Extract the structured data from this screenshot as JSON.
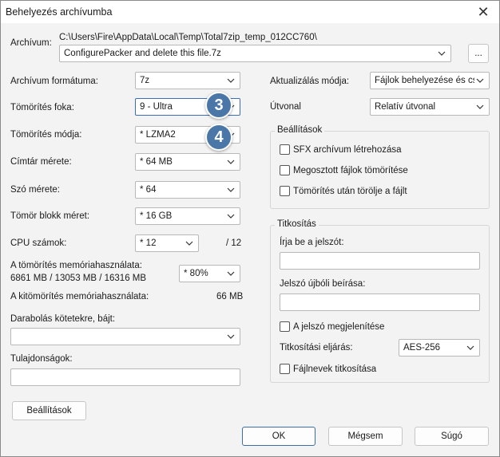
{
  "window": {
    "title": "Behelyezés archívumba",
    "close": "✕"
  },
  "archive": {
    "label": "Archívum:",
    "path": "C:\\Users\\Fire\\AppData\\Local\\Temp\\Total7zip_temp_012CC760\\",
    "name": "ConfigurePacker and delete this file.7z",
    "browse": "..."
  },
  "left": {
    "format_label": "Archívum formátuma:",
    "format_value": "7z",
    "level_label": "Tömörítés foka:",
    "level_value": "9 - Ultra",
    "method_label": "Tömörítés módja:",
    "method_value": "*  LZMA2",
    "dict_label": "Címtár mérete:",
    "dict_value": "*  64 MB",
    "word_label": "Szó mérete:",
    "word_value": "*  64",
    "solid_label": "Tömör blokk méret:",
    "solid_value": "*  16 GB",
    "cpu_label": "CPU számok:",
    "cpu_value": "*  12",
    "cpu_total": "/ 12",
    "mem_comp_label": "A tömörítés memóriahasználata:",
    "mem_comp_detail": "6861 MB / 13053 MB / 16316 MB",
    "mem_comp_value": "*  80%",
    "mem_decomp_label": "A kitömörítés memóriahasználata:",
    "mem_decomp_value": "66 MB",
    "split_label": "Darabolás kötetekre, bájt:",
    "props_label": "Tulajdonságok:",
    "settings_button": "Beállítások"
  },
  "right": {
    "update_label": "Aktualizálás módja:",
    "update_value": "Fájlok behelyezése és cser",
    "path_label": "Útvonal",
    "path_value": "Relatív útvonal",
    "options_title": "Beállítások",
    "opt_sfx": "SFX archívum létrehozása",
    "opt_shared": "Megosztott fájlok tömörítése",
    "opt_delete": "Tömörítés után törölje a fájlt",
    "enc_title": "Titkosítás",
    "enc_pw_label": "Írja be a jelszót:",
    "enc_pw2_label": "Jelszó újbóli beírása:",
    "enc_show": "A jelszó megjelenítése",
    "enc_method_label": "Titkosítási eljárás:",
    "enc_method_value": "AES-256",
    "enc_names": "Fájlnevek titkosítása"
  },
  "footer": {
    "ok": "OK",
    "cancel": "Mégsem",
    "help": "Súgó"
  },
  "badges": {
    "b3": "3",
    "b4": "4"
  },
  "colors": {
    "accent": "#3d6db4",
    "badge": "#4a76a8"
  }
}
